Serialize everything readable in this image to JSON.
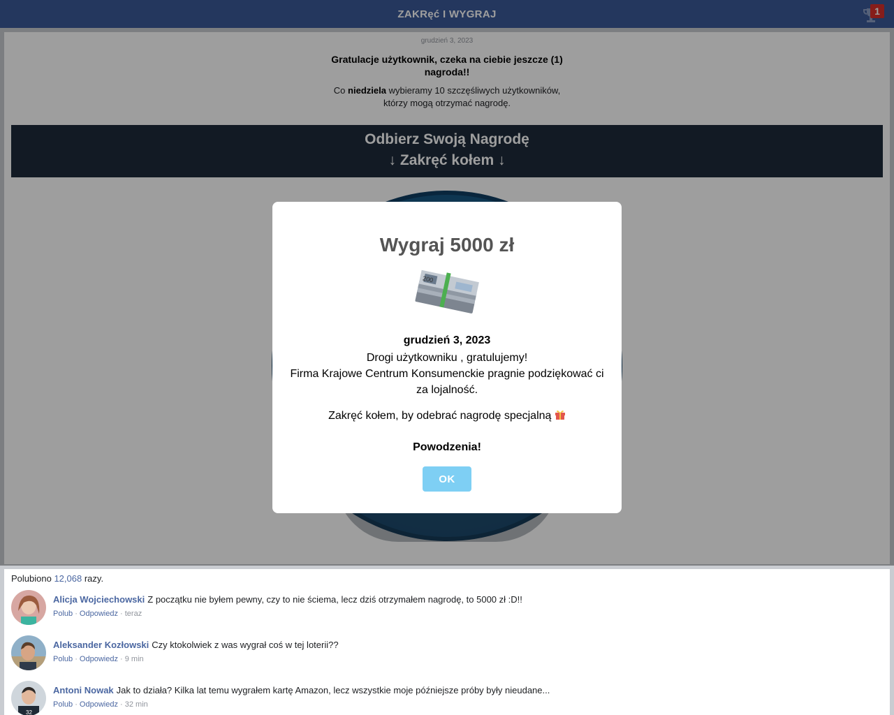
{
  "header": {
    "title": "ZAKRęć I WYGRAJ",
    "badge_count": "1"
  },
  "card": {
    "date": "grudzień 3, 2023",
    "congrats": "Gratulacje użytkownik, czeka na ciebie jeszcze (1) nagroda!!",
    "weekly_prefix": "Co",
    "weekly_bold": "niedziela",
    "weekly_rest": "wybieramy 10 szczęśliwych użytkowników, którzy mogą otrzymać nagrodę.",
    "banner_line1": "Odbierz Swoją Nagrodę",
    "banner_line2": "↓ Zakręć kołem ↓"
  },
  "modal": {
    "title": "Wygraj 5000 zł",
    "date": "grudzień 3, 2023",
    "greeting": "Drogi użytkowniku , gratulujemy!",
    "thanks": "Firma Krajowe Centrum Konsumenckie pragnie podziękować ci za lojalność.",
    "spin": "Zakręć kołem, by odebrać nagrodę specjalną",
    "luck": "Powodzenia!",
    "ok_label": "OK"
  },
  "comments": {
    "likes_prefix": "Polubiono",
    "likes_count": "12,068",
    "likes_suffix": "razy.",
    "like_label": "Polub",
    "reply_label": "Odpowiedz",
    "items": [
      {
        "name": "Alicja Wojciechowski",
        "text": "Z początku nie byłem pewny, czy to nie ściema, lecz dziś otrzymałem nagrodę, to 5000 zł :D!!",
        "time": "teraz"
      },
      {
        "name": "Aleksander Kozłowski",
        "text": "Czy ktokolwiek z was wygrał coś w tej loterii??",
        "time": "9 min"
      },
      {
        "name": "Antoni Nowak",
        "text": "Jak to działa? Kilka lat temu wygrałem kartę Amazon, lecz wszystkie moje późniejsze próby były nieudane...",
        "time": "32 min"
      }
    ]
  }
}
